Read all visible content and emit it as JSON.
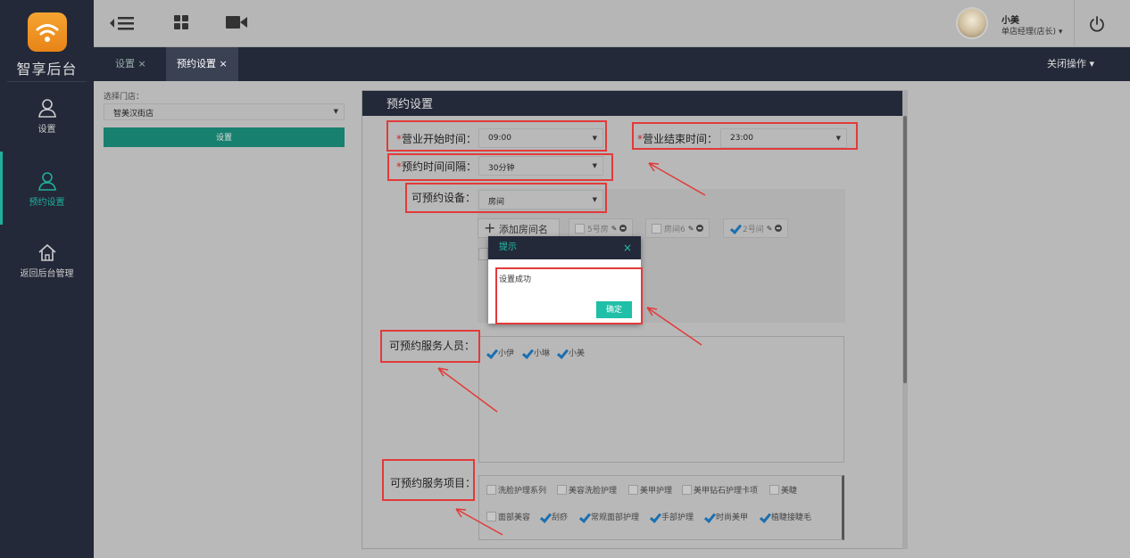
{
  "app": {
    "logo_text": "智享后台"
  },
  "sidebar": {
    "items": [
      {
        "label": "设置",
        "icon": "user-icon"
      },
      {
        "label": "预约设置",
        "icon": "user-icon"
      },
      {
        "label": "返回后台管理",
        "icon": "home-icon"
      }
    ],
    "active_index": 1
  },
  "topbar": {
    "icons": [
      "menu-collapse-icon",
      "grid-icon",
      "video-icon",
      "power-icon"
    ],
    "user_name": "小美",
    "user_role": "单店经理(店长) ▾"
  },
  "tabs": [
    {
      "label": "设置 ×"
    },
    {
      "label": "预约设置 ×"
    }
  ],
  "tabbar": {
    "close_ops": "关闭操作 ▾"
  },
  "store": {
    "label": "选择门店：",
    "selected": "智美汉街店",
    "button": "设置"
  },
  "panel": {
    "title": "预约设置",
    "fields": {
      "open_time": {
        "required": "*",
        "label": "营业开始时间：",
        "value": "09:00"
      },
      "close_time": {
        "required": "*",
        "label": "营业结束时间：",
        "value": "23:00"
      },
      "interval": {
        "required": "*",
        "label": "预约时间间隔：",
        "value": "30分钟"
      },
      "device": {
        "label": "可预约设备：",
        "value": "房间"
      }
    },
    "add_room": "添加房间名",
    "rooms": [
      {
        "label": "5号房",
        "checked": false
      },
      {
        "label": "房间6",
        "checked": false
      },
      {
        "label": "2号间",
        "checked": true
      }
    ],
    "staff_label": "可预约服务人员：",
    "staff": [
      {
        "label": "小伊",
        "checked": true
      },
      {
        "label": "小琳",
        "checked": true
      },
      {
        "label": "小美",
        "checked": true
      }
    ],
    "services_label": "可预约服务项目：",
    "services_row1": [
      {
        "label": "洗脸护理系列",
        "checked": false
      },
      {
        "label": "美容洗脸护理",
        "checked": false
      },
      {
        "label": "美甲护理",
        "checked": false
      },
      {
        "label": "美甲钻石护理卡项",
        "checked": false
      },
      {
        "label": "美睫",
        "checked": false
      }
    ],
    "services_row2": [
      {
        "label": "面部美容",
        "checked": false
      },
      {
        "label": "刮痧",
        "checked": true
      },
      {
        "label": "常规面部护理",
        "checked": true
      },
      {
        "label": "手部护理",
        "checked": true
      },
      {
        "label": "时尚美甲",
        "checked": true
      },
      {
        "label": "植睫接睫毛",
        "checked": true
      }
    ]
  },
  "modal": {
    "title": "提示",
    "close": "×",
    "message": "设置成功",
    "ok": "确定"
  },
  "colors": {
    "sidebar_bg": "#232939",
    "accent": "#1fbfa8",
    "annotation_red": "#e23a3a"
  }
}
